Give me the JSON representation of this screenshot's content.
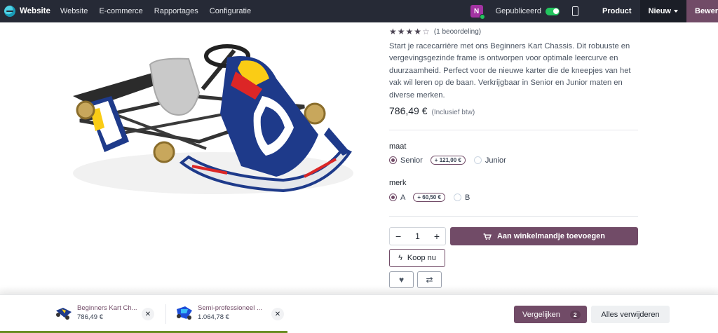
{
  "topbar": {
    "brand": "Website",
    "menu": [
      "Website",
      "E-commerce",
      "Rapportages",
      "Configuratie"
    ],
    "avatar_initial": "N",
    "published_label": "Gepubliceerd",
    "product_label": "Product",
    "new_label": "Nieuw",
    "edit_label": "Bewerken"
  },
  "product": {
    "rating": 4,
    "rating_max": 5,
    "reviews": "(1 beoordeling)",
    "description": "Start je racecarrière met ons Beginners Kart Chassis. Dit robuuste en vergevingsgezinde frame is ontworpen voor optimale leercurve en duurzaamheid. Perfect voor de nieuwe karter die de kneepjes van het vak wil leren op de baan. Verkrijgbaar in Senior en Junior maten en diverse merken.",
    "price": "786,49 €",
    "tax_note": "(Inclusief btw)",
    "attributes": [
      {
        "label": "maat",
        "options": [
          {
            "label": "Senior",
            "extra": "+ 121,00 €",
            "checked": true
          },
          {
            "label": "Junior",
            "extra": "",
            "checked": false
          }
        ]
      },
      {
        "label": "merk",
        "options": [
          {
            "label": "A",
            "extra": "+ 60,50 €",
            "checked": true
          },
          {
            "label": "B",
            "extra": "",
            "checked": false
          }
        ]
      }
    ],
    "quantity": "1",
    "add_to_cart": "Aan winkelmandje toevoegen",
    "buy_now": "Koop nu"
  },
  "compare": {
    "items": [
      {
        "name": "Beginners Kart Ch...",
        "price": "786,49 €"
      },
      {
        "name": "Semi-professioneel ...",
        "price": "1.064,78 €"
      }
    ],
    "compare_label": "Vergelijken",
    "count": "2",
    "remove_all": "Alles verwijderen"
  },
  "colors": {
    "accent": "#714b67",
    "topbar": "#262a36",
    "published_toggle": "#22c55e"
  }
}
